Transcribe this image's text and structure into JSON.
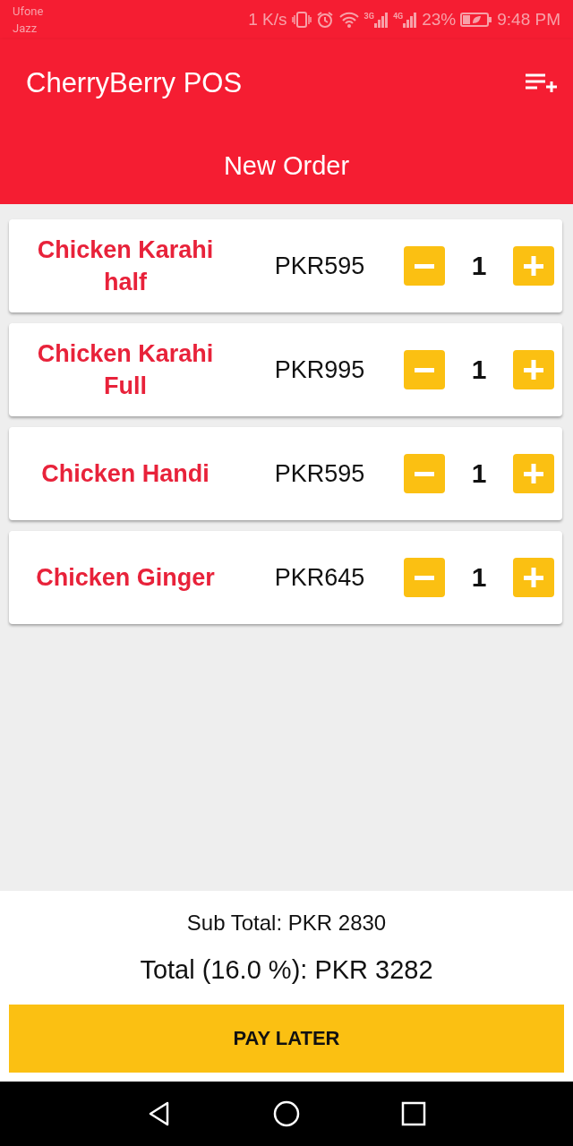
{
  "status_bar": {
    "carriers": [
      "Ufone",
      "Jazz"
    ],
    "speed": "1 K/s",
    "networks": [
      "3G",
      "4G"
    ],
    "battery": "23%",
    "time": "9:48 PM"
  },
  "app_bar": {
    "title": "CherryBerry POS"
  },
  "header": {
    "title": "New Order"
  },
  "items": [
    {
      "name": "Chicken Karahi half",
      "price": "PKR595",
      "quantity": "1"
    },
    {
      "name": "Chicken Karahi Full",
      "price": "PKR995",
      "quantity": "1"
    },
    {
      "name": "Chicken Handi",
      "price": "PKR595",
      "quantity": "1"
    },
    {
      "name": "Chicken Ginger",
      "price": "PKR645",
      "quantity": "1"
    }
  ],
  "summary": {
    "subtotal": "Sub Total: PKR 2830",
    "total": "Total (16.0 %): PKR 3282"
  },
  "pay_button": "PAY LATER"
}
